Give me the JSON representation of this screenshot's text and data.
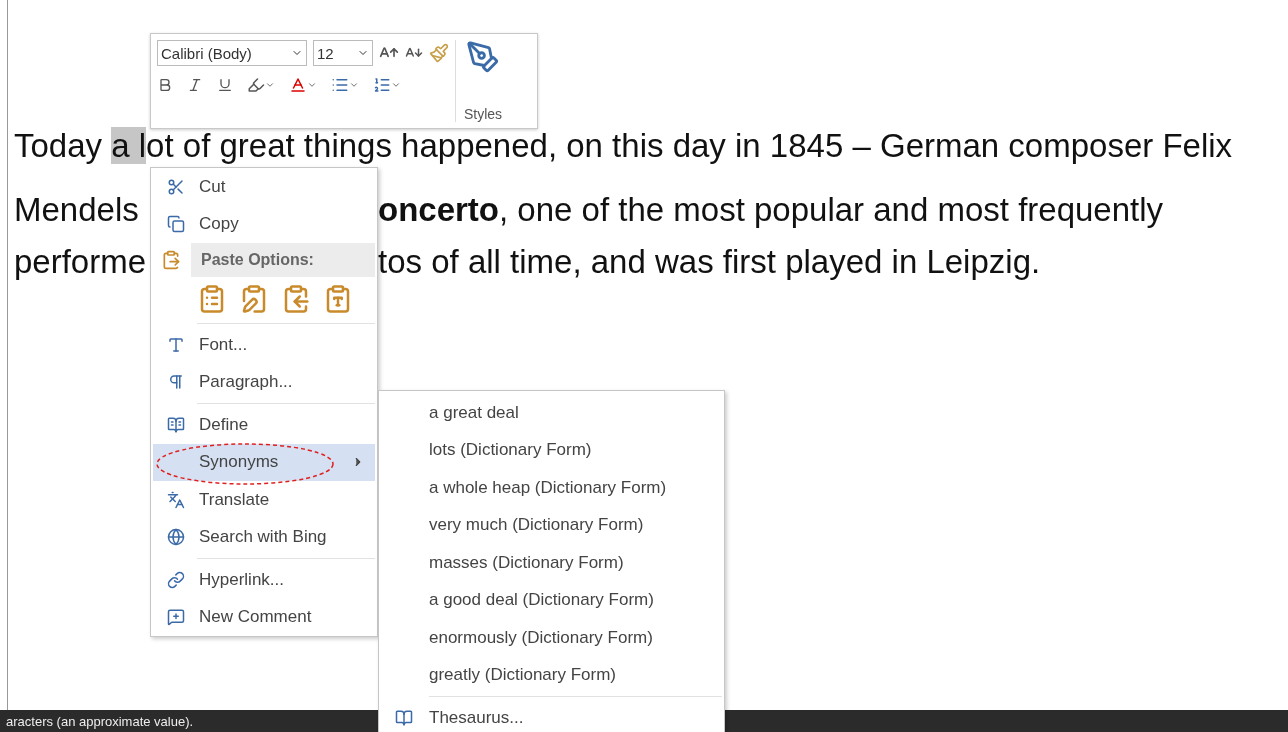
{
  "mini_toolbar": {
    "font": "Calibri (Body)",
    "size": "12",
    "styles_label": "Styles"
  },
  "paragraph": {
    "lines": [
      {
        "kind": "continuous",
        "left": "Today ",
        "selection": "a l",
        "right": "ot of great things happened, on this day in 1845 – German composer Felix"
      },
      {
        "kind": "split",
        "left": "Mendels",
        "right": "**oncerto**, one of the most popular and most frequently"
      },
      {
        "kind": "split",
        "left": "performe",
        "right": "tos of all time, and was first played in Leipzig."
      }
    ]
  },
  "context_menu": {
    "items": [
      {
        "kind": "item",
        "label": "Cut",
        "selected": false
      },
      {
        "kind": "item",
        "label": "Copy",
        "selected": false
      },
      {
        "kind": "header",
        "label": "Paste Options:"
      },
      {
        "kind": "paste_icons"
      },
      {
        "kind": "separator"
      },
      {
        "kind": "item",
        "label": "Font...",
        "selected": false
      },
      {
        "kind": "item",
        "label": "Paragraph...",
        "selected": false
      },
      {
        "kind": "separator"
      },
      {
        "kind": "item",
        "label": "Define",
        "selected": false
      },
      {
        "kind": "submenu",
        "label": "Synonyms",
        "selected": true
      },
      {
        "kind": "item",
        "label": "Translate",
        "selected": false
      },
      {
        "kind": "item",
        "label": "Search with Bing",
        "selected": false
      },
      {
        "kind": "separator"
      },
      {
        "kind": "item",
        "label": "Hyperlink...",
        "selected": false
      },
      {
        "kind": "item",
        "label": "New Comment",
        "selected": false
      }
    ]
  },
  "synonyms_menu": {
    "items": [
      {
        "kind": "item",
        "label": "a great deal"
      },
      {
        "kind": "item",
        "label": "lots (Dictionary Form)"
      },
      {
        "kind": "item",
        "label": "a whole heap (Dictionary Form)"
      },
      {
        "kind": "item",
        "label": "very much (Dictionary Form)"
      },
      {
        "kind": "item",
        "label": "masses (Dictionary Form)"
      },
      {
        "kind": "item",
        "label": "a good deal (Dictionary Form)"
      },
      {
        "kind": "item",
        "label": "enormously (Dictionary Form)"
      },
      {
        "kind": "item",
        "label": "greatly (Dictionary Form)"
      },
      {
        "kind": "separator"
      },
      {
        "kind": "item",
        "label": "Thesaurus..."
      }
    ]
  },
  "status_bar": {
    "text": "aracters (an approximate value)."
  }
}
